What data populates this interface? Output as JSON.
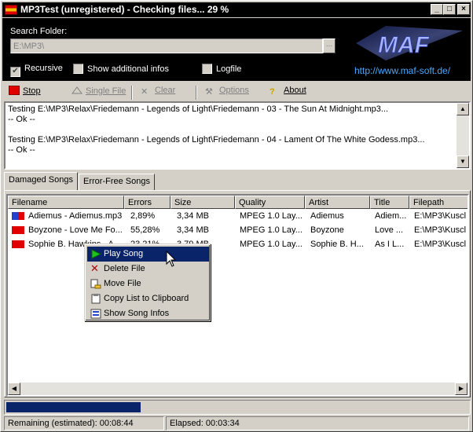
{
  "window": {
    "title": "MP3Test (unregistered) - Checking files... 29 %",
    "buttons": {
      "minimize": "_",
      "maximize": "□",
      "close": "×"
    }
  },
  "header": {
    "search_label": "Search Folder:",
    "search_value": "E:\\MP3\\",
    "browse_label": "...",
    "recursive_label": "Recursive",
    "recursive_checked": true,
    "additional_label": "Show additional infos",
    "additional_checked": false,
    "logfile_label": "Logfile",
    "logfile_checked": false,
    "url": "http://www.maf-soft.de/",
    "logo_text": "MAF"
  },
  "toolbar": {
    "stop": "Stop",
    "single_file": "Single File",
    "clear": "Clear",
    "options": "Options",
    "about": "About"
  },
  "log": {
    "text": "Testing E:\\MP3\\Relax\\Friedemann - Legends of Light\\Friedemann - 03 - The Sun At Midnight.mp3...\n-- Ok --\n\nTesting E:\\MP3\\Relax\\Friedemann - Legends of Light\\Friedemann - 04 - Lament Of The White Godess.mp3...\n-- Ok --\n"
  },
  "tabs": [
    "Damaged Songs",
    "Error-Free Songs"
  ],
  "list": {
    "columns": [
      "Filename",
      "Errors",
      "Size",
      "Quality",
      "Artist",
      "Title",
      "Filepath"
    ],
    "rows": [
      {
        "filename": "Adiemus - Adiemus.mp3",
        "errors": "2,89%",
        "size": "3,34 MB",
        "quality": "MPEG 1.0 Lay...",
        "artist": "Adiemus",
        "title": "Adiem...",
        "filepath": "E:\\MP3\\Kuscl",
        "severity_color": "#2244cc"
      },
      {
        "filename": "Boyzone - Love Me Fo...",
        "errors": "55,28%",
        "size": "3,34 MB",
        "quality": "MPEG 1.0 Lay...",
        "artist": "Boyzone",
        "title": "Love ...",
        "filepath": "E:\\MP3\\Kuscl",
        "severity_color": "#e00000"
      },
      {
        "filename": "Sophie B. Hawkins - A...",
        "errors": "23,21%",
        "size": "3,79 MB",
        "quality": "MPEG 1.0 Lay...",
        "artist": "Sophie B. H...",
        "title": "As I L...",
        "filepath": "E:\\MP3\\Kuscl",
        "severity_color": "#e00000"
      }
    ]
  },
  "context_menu": {
    "items": [
      "Play Song",
      "Delete File",
      "Move File",
      "Copy List to Clipboard",
      "Show Song Infos"
    ],
    "highlighted": 0
  },
  "progress": {
    "fraction": 0.29
  },
  "status": {
    "remaining": "Remaining (estimated): 00:08:44",
    "elapsed": "Elapsed: 00:03:34"
  }
}
